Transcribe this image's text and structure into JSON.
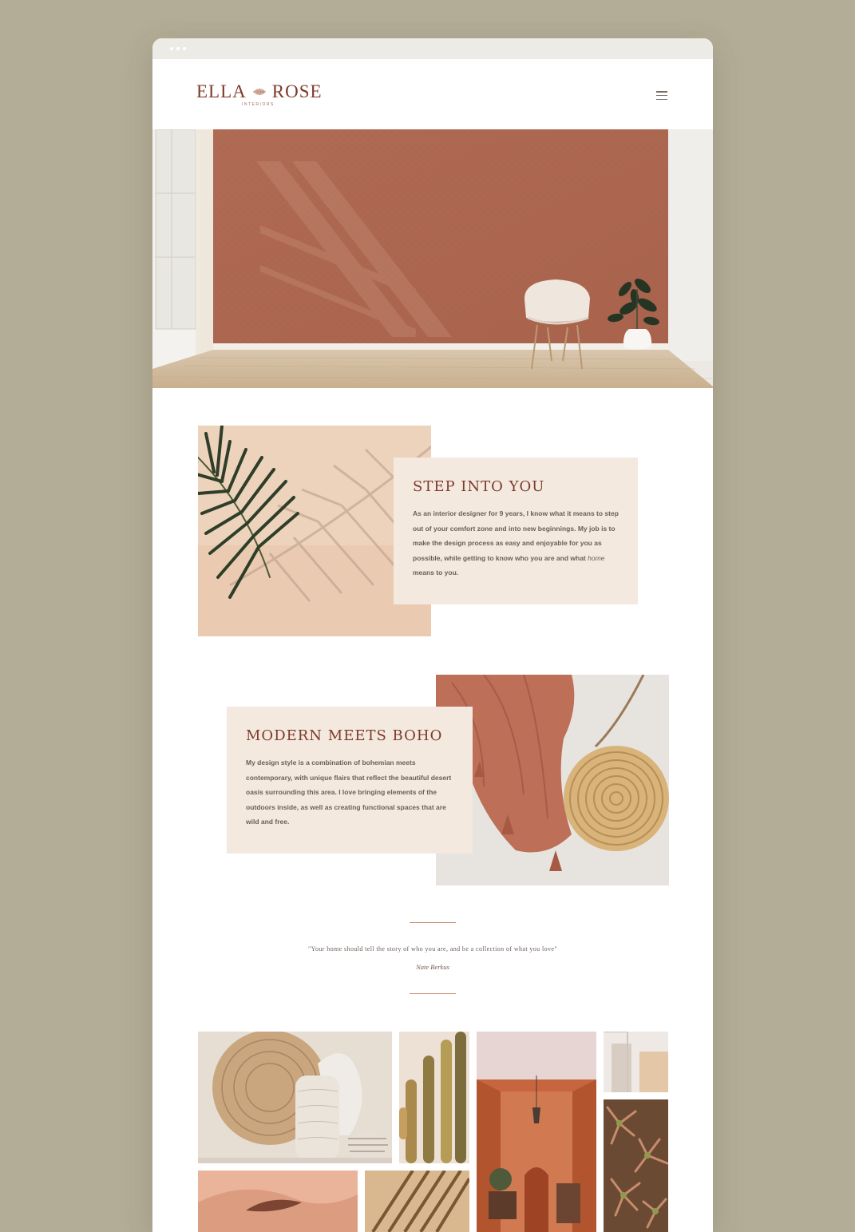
{
  "site": {
    "logo_left": "ELLA",
    "logo_right": "ROSE",
    "logo_sub": "INTERIORS"
  },
  "hero": {
    "image_alt": "terracotta-wall-room-with-chair-and-plant"
  },
  "features": [
    {
      "title": "STEP INTO YOU",
      "text_before": "As an interior designer for 9 years, I know what it means to step out of your comfort zone and into new beginnings. My job is to make the design process as easy and enjoyable for you as possible, while getting to know who you are and what ",
      "text_em": "home",
      "text_after": " means to you.",
      "image_alt": "palm-leaf-shadow"
    },
    {
      "title": "MODERN MEETS BOHO",
      "text": "My design style is a combination of bohemian meets contemporary, with unique flairs that reflect the beautiful desert oasis surrounding this area. I love bringing elements of the outdoors inside, as well as creating functional spaces that are wild and free.",
      "image_alt": "rust-throw-and-rattan-bag"
    }
  ],
  "quote": {
    "text": "\"Your home should tell the story of who you are, and be a collection of what you love\"",
    "author": "Nate Berkus"
  },
  "colors": {
    "background": "#b3ad97",
    "accent": "#7d3a2a",
    "card": "#f3e9df",
    "terracotta": "#b5715b"
  }
}
